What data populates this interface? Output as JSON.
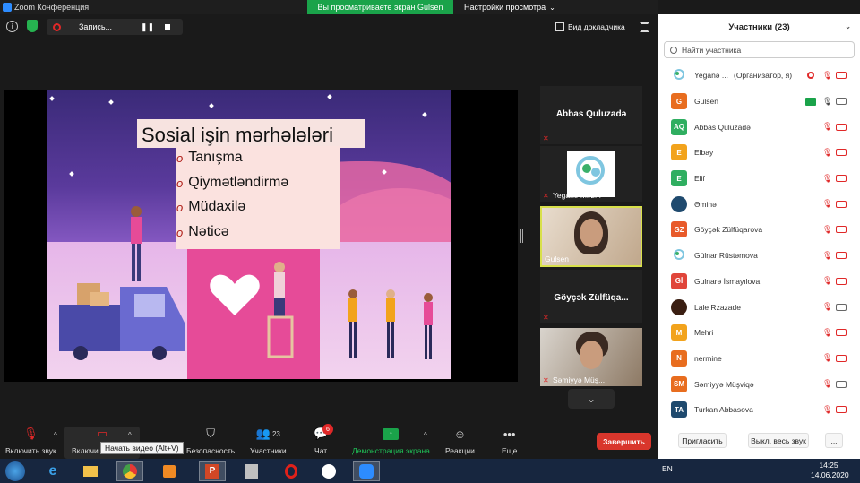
{
  "window": {
    "title": "Zoom Конференция",
    "sharing_banner": "Вы просматриваете экран Gulsen",
    "view_settings": "Настройки просмотра"
  },
  "topbar": {
    "recording_label": "Запись...",
    "speaker_view_label": "Вид докладчика"
  },
  "slide": {
    "title": "Sosial işin mərhələləri",
    "items": [
      "Tanışma",
      "Qiymətləndirmə",
      "Müdaxilə",
      "Nəticə"
    ],
    "bullet": "o"
  },
  "thumbnails": [
    {
      "name": "Abbas Quluzadə",
      "kind": "name-only",
      "muted": true
    },
    {
      "name": "Yeganə Mirz...",
      "kind": "logo",
      "muted": true
    },
    {
      "name": "Gulsen",
      "kind": "camera",
      "muted": false,
      "active": true
    },
    {
      "name": "Göyçək  Zülfüqa...",
      "kind": "name-only",
      "muted": true
    },
    {
      "name": "Səmiyyə Müş...",
      "kind": "camera",
      "muted": true
    }
  ],
  "toolbar": {
    "mute_label": "Включить звук",
    "video_label": "Включи",
    "tooltip": "Начать видео (Alt+V)",
    "security_label": "Безопасность",
    "participants_label": "Участники",
    "participants_count": "23",
    "chat_label": "Чат",
    "chat_badge": "6",
    "share_label": "Демонстрация экрана",
    "reactions_label": "Реакции",
    "more_label": "Еще",
    "end_label": "Завершить"
  },
  "panel": {
    "title": "Участники (23)",
    "search_placeholder": "Найти участника",
    "participants": [
      {
        "initials": "",
        "name": "Yeganə ...",
        "extra": "(Организатор, я)",
        "color": "#ffffff",
        "logo": true,
        "mic": "muted",
        "cam": "off",
        "rec": true
      },
      {
        "initials": "G",
        "name": "Gulsen",
        "extra": "",
        "color": "#e86d1f",
        "mic": "on",
        "cam": "on",
        "share": true
      },
      {
        "initials": "AQ",
        "name": "Abbas Quluzadə",
        "extra": "",
        "color": "#2fae60",
        "mic": "muted",
        "cam": "off"
      },
      {
        "initials": "E",
        "name": "Elbay",
        "extra": "",
        "color": "#f2a31c",
        "mic": "muted",
        "cam": "off"
      },
      {
        "initials": "E",
        "name": "Elif",
        "extra": "",
        "color": "#2fae60",
        "mic": "muted",
        "cam": "off"
      },
      {
        "initials": "",
        "name": "Əminə",
        "extra": "",
        "color": "#1f4a6e",
        "photo": true,
        "mic": "muted",
        "cam": "off"
      },
      {
        "initials": "GZ",
        "name": "Göyçək Zülfüqarova",
        "extra": "",
        "color": "#e85a2a",
        "mic": "muted",
        "cam": "off"
      },
      {
        "initials": "",
        "name": "Gülnar Rüstəmova",
        "extra": "",
        "color": "#ffffff",
        "logo": true,
        "mic": "muted",
        "cam": "off"
      },
      {
        "initials": "Gİ",
        "name": "Gulnarə İsmayılova",
        "extra": "",
        "color": "#e0453a",
        "mic": "muted",
        "cam": "off"
      },
      {
        "initials": "",
        "name": "Lale Rzazade",
        "extra": "",
        "color": "#3a1e12",
        "photo": true,
        "mic": "muted",
        "cam": "on"
      },
      {
        "initials": "M",
        "name": "Mehri",
        "extra": "",
        "color": "#f2a31c",
        "mic": "muted",
        "cam": "off"
      },
      {
        "initials": "N",
        "name": "nermine",
        "extra": "",
        "color": "#e86d1f",
        "mic": "muted",
        "cam": "off"
      },
      {
        "initials": "SM",
        "name": "Səmiyyə Müşviqə",
        "extra": "",
        "color": "#e86d1f",
        "mic": "muted",
        "cam": "on"
      },
      {
        "initials": "TA",
        "name": "Turkan Abbasova",
        "extra": "",
        "color": "#1f4a6e",
        "mic": "muted",
        "cam": "off"
      }
    ],
    "invite_label": "Пригласить",
    "mute_all_label": "Выкл. весь звук",
    "more_label": "..."
  },
  "taskbar": {
    "lang": "EN",
    "time": "14:25",
    "date": "14.06.2020"
  },
  "colors": {
    "accent_green": "#1aa34a",
    "end_red": "#d9362c",
    "muted_red": "#e02828",
    "active_border": "#d8e04a"
  }
}
